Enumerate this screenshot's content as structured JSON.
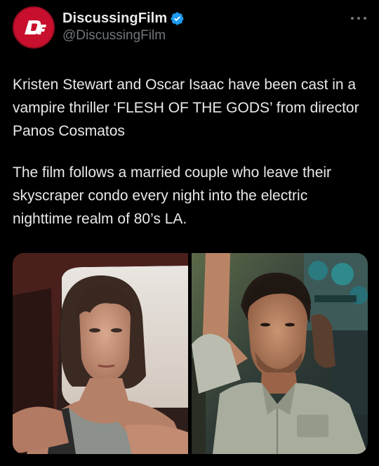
{
  "account": {
    "display_name": "DiscussingFilm",
    "handle": "@DiscussingFilm",
    "verified": true,
    "avatar_icon": "discussingfilm-logo-icon",
    "avatar_color": "#c8102e"
  },
  "tweet": {
    "paragraphs": [
      "Kristen Stewart and Oscar Isaac have been cast in a vampire thriller ‘FLESH OF THE GODS’ from director Panos Cosmatos",
      "The film follows a married couple who leave their skyscraper condo every night into the electric nighttime realm of 80’s LA."
    ]
  },
  "media": {
    "images": [
      {
        "icon": "photo-kristen-stewart"
      },
      {
        "icon": "photo-oscar-isaac"
      }
    ]
  },
  "colors": {
    "background": "#000000",
    "text_primary": "#e7e9ea",
    "text_secondary": "#71767b",
    "verified_blue": "#1d9bf0"
  }
}
